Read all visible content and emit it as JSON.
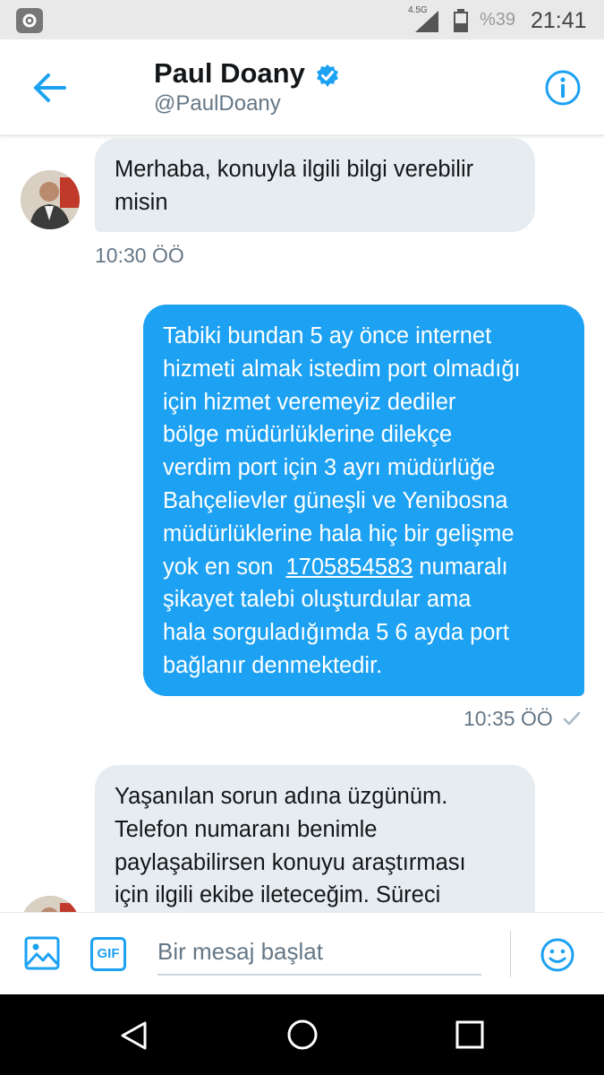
{
  "status_bar": {
    "network": "4.5G",
    "battery": "%39",
    "time": "21:41"
  },
  "header": {
    "name": "Paul Doany",
    "handle": "@PaulDoany"
  },
  "messages": [
    {
      "direction": "in",
      "lines": [
        "Merhaba,  konuyla ilgili bilgi verebilir",
        "misin"
      ],
      "time": "10:30 ÖÖ"
    },
    {
      "direction": "out",
      "lines": [
        "Tabiki bundan 5 ay önce internet",
        "hizmeti almak istedim port olmadığı",
        "için hizmet veremeyiz dediler",
        "bölge müdürlüklerine dilekçe",
        "verdim port için 3 ayrı müdürlüğe",
        "Bahçelievler güneşli ve Yenibosna",
        "müdürlüklerine hala hiç bir gelişme"
      ],
      "line8_prefix": "yok en son  ",
      "phone": "1705854583",
      "line8_suffix": " numaralı",
      "lines_after": [
        "şikayet talebi oluşturdular ama",
        "hala sorguladığımda 5 6 ayda port",
        "bağlanır denmektedir."
      ],
      "time": "10:35 ÖÖ"
    },
    {
      "direction": "in",
      "lines": [
        "Yaşanılan sorun adına üzgünüm.",
        "Telefon numaranı benimle",
        "paylaşabilirsen konuyu araştırması",
        "için ilgili ekibe ileteceğim. Süreci"
      ]
    }
  ],
  "composer": {
    "placeholder": "Bir mesaj başlat",
    "gif_label": "GIF"
  },
  "colors": {
    "accent": "#1da1f2",
    "incoming_bubble": "#e6ecf0",
    "text": "#14171a",
    "secondary": "#657786"
  }
}
